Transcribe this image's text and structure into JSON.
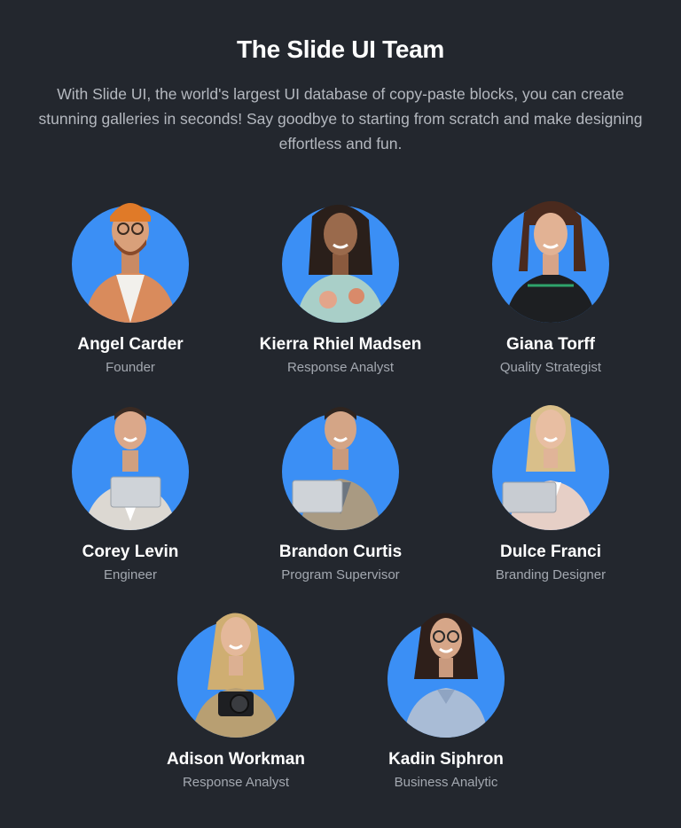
{
  "header": {
    "title": "The Slide UI Team",
    "description": "With Slide UI, the world's largest UI database of copy-paste blocks, you can create stunning galleries in seconds! Say goodbye to starting from scratch and make designing effortless and fun."
  },
  "colors": {
    "background": "#23272e",
    "avatar_circle": "#3b8ff5",
    "name_text": "#ffffff",
    "role_text": "#a3a8b0"
  },
  "team": [
    {
      "name": "Angel Carder",
      "role": "Founder"
    },
    {
      "name": "Kierra Rhiel Madsen",
      "role": "Response Analyst"
    },
    {
      "name": "Giana Torff",
      "role": "Quality Strategist"
    },
    {
      "name": "Corey Levin",
      "role": "Engineer"
    },
    {
      "name": "Brandon Curtis",
      "role": "Program Supervisor"
    },
    {
      "name": "Dulce Franci",
      "role": "Branding Designer"
    },
    {
      "name": "Adison Workman",
      "role": "Response Analyst"
    },
    {
      "name": "Kadin Siphron",
      "role": "Business Analytic"
    }
  ]
}
